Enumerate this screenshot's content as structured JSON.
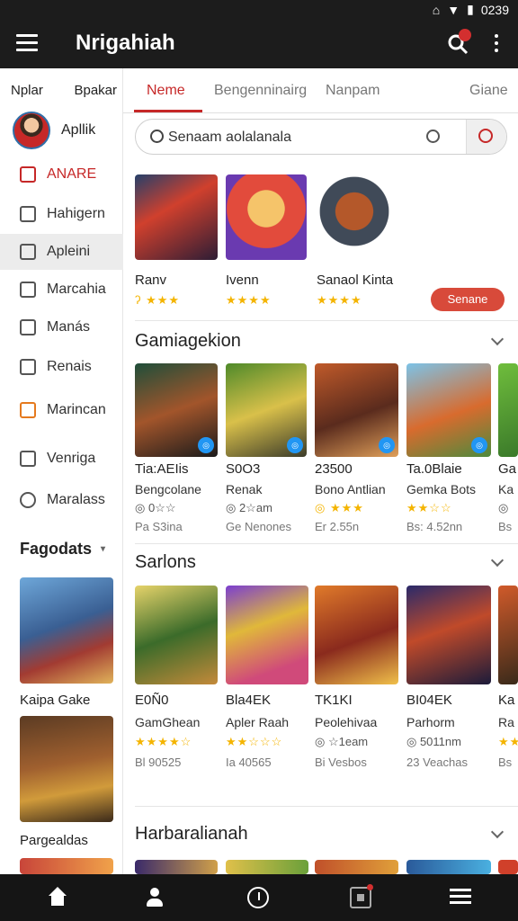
{
  "status": {
    "time": "0239"
  },
  "appbar": {
    "title": "Nrigahiah"
  },
  "sidebar": {
    "top_left": "Nplar",
    "top_right": "Bpakar",
    "profile_name": "Apllik",
    "items": [
      {
        "label": "ANARE",
        "icon": "grid-icon"
      },
      {
        "label": "Hahigern",
        "icon": "folder-icon"
      },
      {
        "label": "Apleini",
        "icon": "chat-icon"
      },
      {
        "label": "Marcahia",
        "icon": "chart-icon"
      },
      {
        "label": "Manás",
        "icon": "calendar-icon"
      },
      {
        "label": "Renais",
        "icon": "image-icon"
      },
      {
        "label": "Marincan",
        "icon": "flag-icon"
      },
      {
        "label": "Venriga",
        "icon": "home-icon"
      },
      {
        "label": "Maralass",
        "icon": "star-icon"
      }
    ],
    "heading": "Fagodats",
    "cards": [
      {
        "label": "Kaipa Gake"
      },
      {
        "label": "Pargealdas"
      }
    ]
  },
  "tabs": [
    "Neme",
    "Bengenninairg",
    "Nanpam",
    "Giane"
  ],
  "search": {
    "value": "Senaam aolalanala"
  },
  "featured": {
    "items": [
      {
        "name": "Ranv",
        "rating": "ʔ ★★★"
      },
      {
        "name": "Ivenn",
        "rating": "★★★★"
      },
      {
        "name": "Sanaol Kinta",
        "rating": "★★★★"
      }
    ],
    "button": "Senane"
  },
  "sections": [
    {
      "title": "Gamiagekion",
      "items": [
        {
          "name": "Tia:AEIis",
          "sub": "Bengcolane",
          "rating": "◎ 0☆☆",
          "extra": "Pa S3ina"
        },
        {
          "name": "S0O3",
          "sub": "Renak",
          "rating": "◎ 2☆am",
          "extra": "Ge Nenones"
        },
        {
          "name": "23500",
          "sub": "Bono Antlian",
          "rating": "◎ ★★★",
          "extra": "Er 2.55n"
        },
        {
          "name": "Ta.0Blaie",
          "sub": "Gemka Bots",
          "rating": "★★☆☆",
          "extra": "Bs: 4.52nn"
        },
        {
          "name": "Ga",
          "sub": "Ka",
          "rating": "◎",
          "extra": "Bs"
        }
      ]
    },
    {
      "title": "Sarlons",
      "items": [
        {
          "name": "E0Ñ0",
          "sub": "GamGhean",
          "rating": "★★★★☆",
          "extra": "Bl 90525"
        },
        {
          "name": "Bla4EK",
          "sub": "Apler Raah",
          "rating": "★★☆☆☆",
          "extra": "Ia 40565"
        },
        {
          "name": "TK1KI",
          "sub": "Peolehivaa",
          "rating": "◎ ☆1eam",
          "extra": "Bi Vesbos"
        },
        {
          "name": "BI04EK",
          "sub": "Parhorm",
          "rating": "◎ 5011nm",
          "extra": "23 Veachas"
        },
        {
          "name": "Ka",
          "sub": "Ra",
          "rating": "★★",
          "extra": "Bs"
        }
      ]
    },
    {
      "title": "Harbaralianah"
    }
  ],
  "nav": [
    "home-icon",
    "person-icon",
    "clock-icon",
    "box-icon",
    "list-icon"
  ],
  "colors": {
    "accent": "#c62828",
    "dark": "#1c1c1c",
    "star": "#f4b400"
  }
}
